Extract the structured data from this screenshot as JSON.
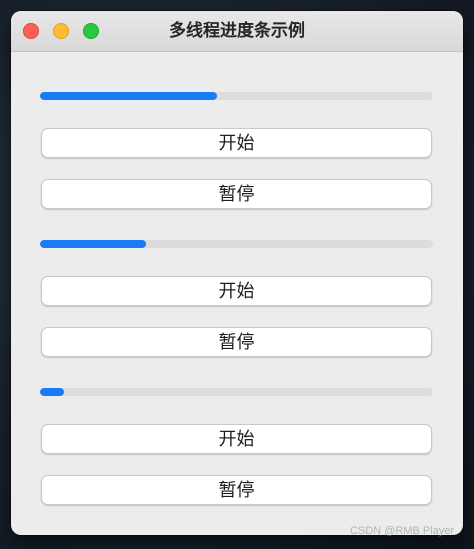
{
  "window": {
    "title": "多线程进度条示例"
  },
  "groups": [
    {
      "progress": 0.45,
      "start_label": "开始",
      "pause_label": "暂停"
    },
    {
      "progress": 0.27,
      "start_label": "开始",
      "pause_label": "暂停"
    },
    {
      "progress": 0.06,
      "start_label": "开始",
      "pause_label": "暂停"
    }
  ],
  "colors": {
    "progress_fill": "#1a7cf5",
    "progress_track": "#dcdcdc"
  },
  "watermark": "CSDN @RMB Player"
}
